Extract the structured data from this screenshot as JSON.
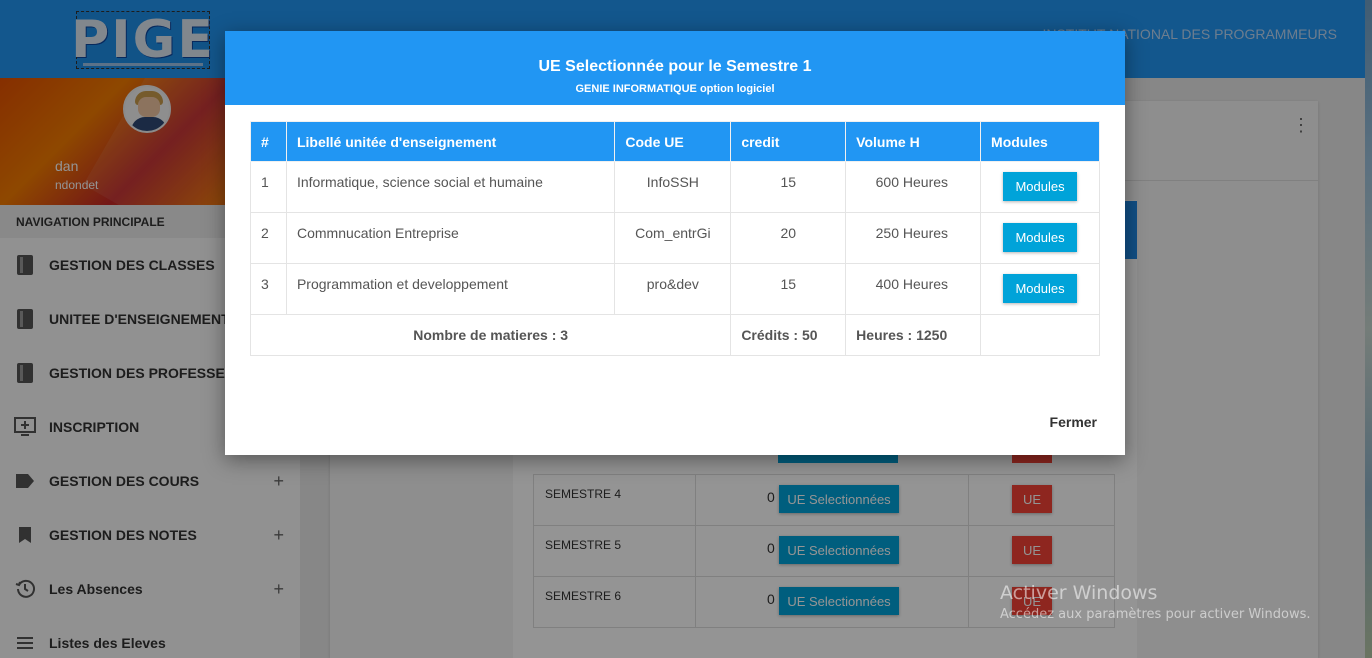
{
  "header": {
    "logo_text": "PIGE",
    "institute": "INSTITUT NATIONAL DES PROGRAMMEURS"
  },
  "sidebar": {
    "user": {
      "name": "dan",
      "email": "ndondet"
    },
    "nav_header": "NAVIGATION PRINCIPALE",
    "items": [
      {
        "label": "GESTION DES CLASSES",
        "icon": "book-icon",
        "expandable": false
      },
      {
        "label": "UNITEE D'ENSEIGNEMENT",
        "icon": "book-icon",
        "expandable": false
      },
      {
        "label": "GESTION DES PROFESSEURS",
        "icon": "book-icon",
        "expandable": false
      },
      {
        "label": "INSCRIPTION",
        "icon": "add-to-queue-icon",
        "expandable": false
      },
      {
        "label": "GESTION DES COURS",
        "icon": "label-icon",
        "expandable": true
      },
      {
        "label": "GESTION DES NOTES",
        "icon": "bookmark-icon",
        "expandable": true
      },
      {
        "label": "Les Absences",
        "icon": "history-icon",
        "expandable": true
      },
      {
        "label": "Listes des Eleves",
        "icon": "list-icon",
        "expandable": false
      }
    ],
    "plus_symbol": "+"
  },
  "background": {
    "card_menu": "⋮",
    "semesters": [
      {
        "label": "SEMESTRE 4",
        "count": "0",
        "ue_selected_label": "UE Selectionnées",
        "ue_label": "UE"
      },
      {
        "label": "SEMESTRE 5",
        "count": "0",
        "ue_selected_label": "UE Selectionnées",
        "ue_label": "UE"
      },
      {
        "label": "SEMESTRE 6",
        "count": "0",
        "ue_selected_label": "UE Selectionnées",
        "ue_label": "UE"
      }
    ]
  },
  "modal": {
    "title": "UE Selectionnée pour le Semestre 1",
    "subtitle": "GENIE INFORMATIQUE option logiciel",
    "columns": [
      "#",
      "Libellé unitée d'enseignement",
      "Code UE",
      "credit",
      "Volume H",
      "Modules"
    ],
    "rows": [
      {
        "num": "1",
        "libelle": "Informatique, science social et humaine",
        "code": "InfoSSH",
        "credit": "15",
        "volume": "600 Heures",
        "button": "Modules"
      },
      {
        "num": "2",
        "libelle": "Commnucation Entreprise",
        "code": "Com_entrGi",
        "credit": "20",
        "volume": "250 Heures",
        "button": "Modules"
      },
      {
        "num": "3",
        "libelle": "Programmation et developpement",
        "code": "pro&dev",
        "credit": "15",
        "volume": "400 Heures",
        "button": "Modules"
      }
    ],
    "totals": {
      "matieres": "Nombre de matieres : 3",
      "credits": "Crédits : 50",
      "heures": "Heures : 1250"
    },
    "close_label": "Fermer"
  },
  "watermark": {
    "line1": "Activer Windows",
    "line2": "Accédez aux paramètres pour activer Windows."
  },
  "colors": {
    "primary": "#2196f3",
    "cyan_button": "#00a3d9",
    "red_button": "#f44336"
  }
}
